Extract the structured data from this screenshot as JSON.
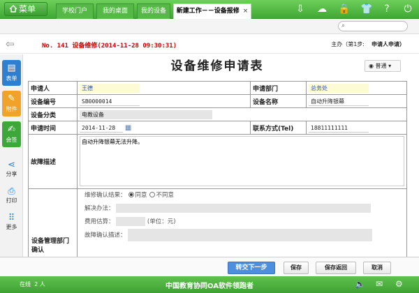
{
  "topbar": {
    "menu_label": "菜单",
    "tabs": [
      {
        "label": "学校门户"
      },
      {
        "label": "我的桌面"
      },
      {
        "label": "我的设备"
      },
      {
        "label": "新建工作－－设备报修",
        "close": "×"
      }
    ],
    "icons": [
      "download-icon",
      "cloud-icon",
      "lock-icon",
      "shirt-icon",
      "help-icon",
      "power-icon"
    ]
  },
  "search": {
    "placeholder": ""
  },
  "header": {
    "doc_title": "No. 141 设备维修(2014-11-28 09:30:31)",
    "step_label": "主办（第1步:",
    "step_name": "申请人申请）"
  },
  "sidebar": {
    "items": [
      {
        "label": "表单",
        "icon": "form-icon",
        "color": "#2f7fd0"
      },
      {
        "label": "附件",
        "icon": "paperclip-icon",
        "color": "#f0a22a"
      },
      {
        "label": "会签",
        "icon": "edit-icon",
        "color": "#3ea73a"
      }
    ],
    "tools": [
      {
        "label": "分享",
        "icon": "share-icon"
      },
      {
        "label": "打印",
        "icon": "print-icon"
      },
      {
        "label": "更多",
        "icon": "more-icon"
      }
    ]
  },
  "form": {
    "title": "设备维修申请表",
    "mode_label": "普通",
    "rows": {
      "applicant_label": "申请人",
      "applicant_value": "王德",
      "dept_label": "申请部门",
      "dept_value": "总务处",
      "code_label": "设备编号",
      "code_value": "SB0000014",
      "name_label": "设备名称",
      "name_value": "自动升降银幕",
      "category_label": "设备分类",
      "category_value": "电教设备",
      "time_label": "申请时间",
      "time_value": "2014-11-28",
      "contact_label": "联系方式(Tel)",
      "contact_value": "18811111111",
      "fault_label": "故障描述",
      "fault_value": "自动升降银幕无法升降。",
      "dept_confirm_label": "设备管理部门确认",
      "confirm_result_label": "维修确认结果：",
      "agree_label": "同意",
      "disagree_label": "不同意",
      "solution_label": "解决办法：",
      "cost_label": "费用估算：",
      "cost_unit": "(单位：元)",
      "fault_confirm_label": "故障确认描述："
    }
  },
  "actions": {
    "submit": "转交下一步",
    "save": "保存",
    "save_return": "保存返回",
    "cancel": "取消"
  },
  "status": {
    "online_label": "在线",
    "online_count": "2",
    "online_unit": "人",
    "brand": "中国教育协同OA软件领跑者"
  }
}
